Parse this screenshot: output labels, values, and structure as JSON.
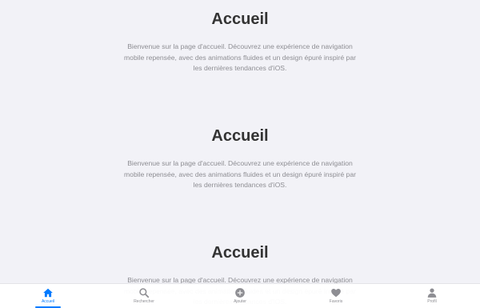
{
  "sections": [
    {
      "title": "Accueil",
      "text": "Bienvenue sur la page d'accueil. Découvrez une expérience de navigation mobile repensée, avec des animations fluides et un design épuré inspiré par les dernières tendances d'iOS."
    },
    {
      "title": "Accueil",
      "text": "Bienvenue sur la page d'accueil. Découvrez une expérience de navigation mobile repensée, avec des animations fluides et un design épuré inspiré par les dernières tendances d'iOS."
    },
    {
      "title": "Accueil",
      "text": "Bienvenue sur la page d'accueil. Découvrez une expérience de navigation mobile repensée, avec des animations fluides et un design épuré inspiré par les dernières tendances d'iOS."
    }
  ],
  "tabbar": {
    "active_index": 0,
    "active_color": "#007aff",
    "inactive_color": "#8e8e93",
    "tabs": [
      {
        "label": "Accueil",
        "icon": "home-icon"
      },
      {
        "label": "Rechercher",
        "icon": "search-icon"
      },
      {
        "label": "Ajouter",
        "icon": "add-circle-icon"
      },
      {
        "label": "Favoris",
        "icon": "heart-icon"
      },
      {
        "label": "Profil",
        "icon": "person-icon"
      }
    ]
  }
}
